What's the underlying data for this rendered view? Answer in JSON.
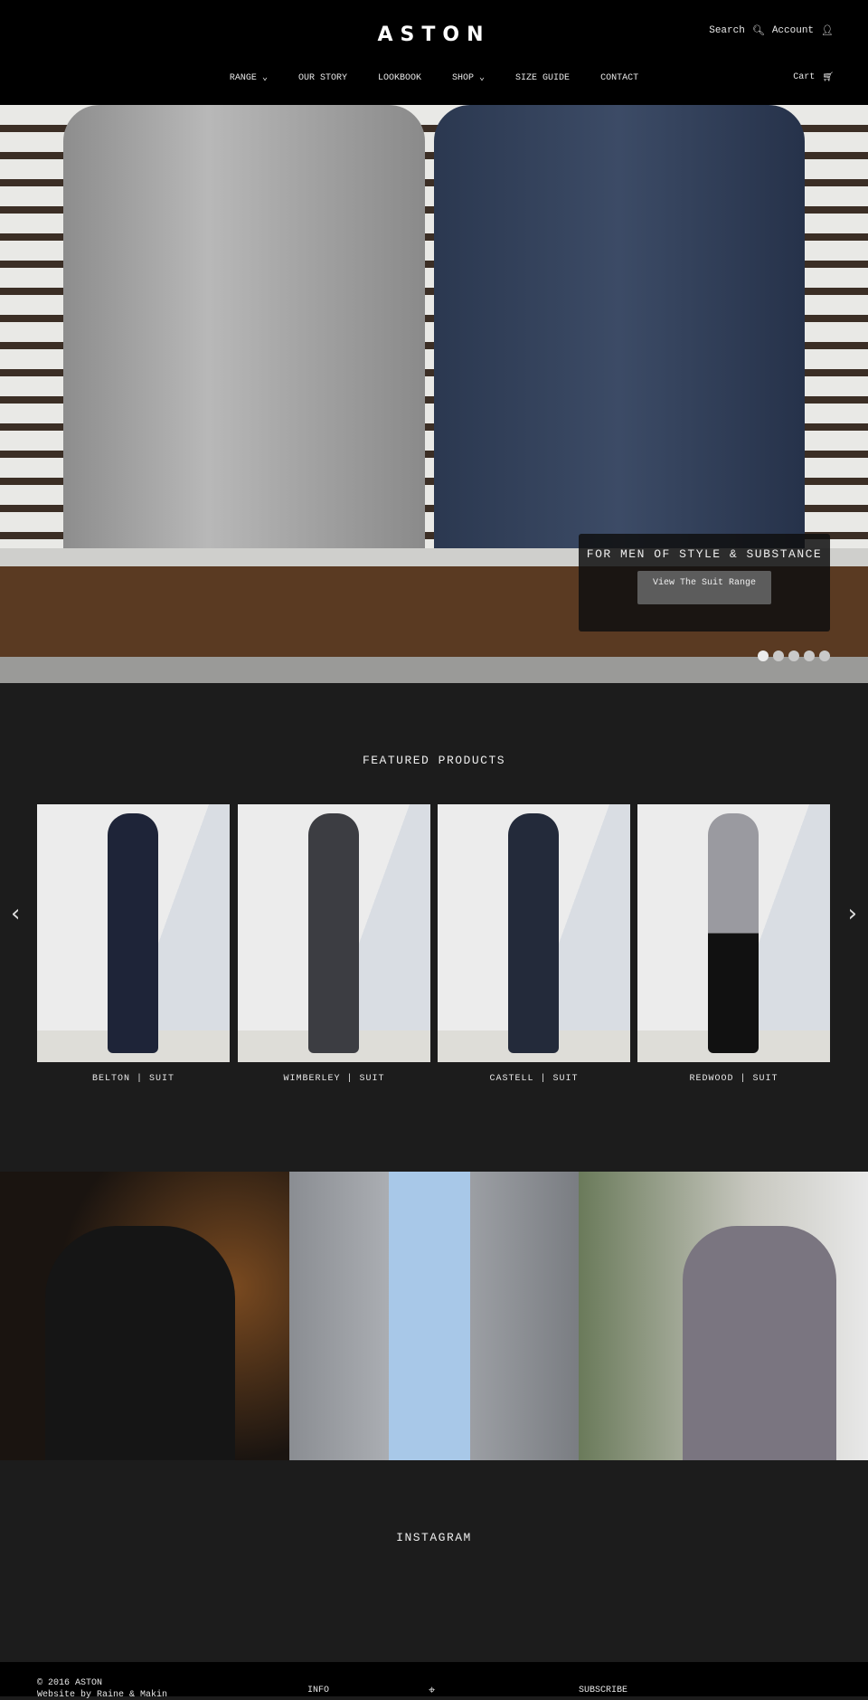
{
  "header": {
    "logo": "ASTON",
    "search_label": "Search",
    "account_label": "Account",
    "cart_label": "Cart",
    "nav": [
      {
        "label": "RANGE",
        "dropdown": true
      },
      {
        "label": "OUR STORY"
      },
      {
        "label": "LOOKBOOK"
      },
      {
        "label": "SHOP",
        "dropdown": true
      },
      {
        "label": "SIZE GUIDE"
      },
      {
        "label": "CONTACT"
      }
    ]
  },
  "hero": {
    "caption": "FOR MEN OF STYLE & SUBSTANCE",
    "button": "View The Suit Range",
    "slides": 5,
    "active_slide": 1
  },
  "featured": {
    "title": "FEATURED PRODUCTS",
    "products": [
      {
        "label": "BELTON | SUIT",
        "color": "#1e2438"
      },
      {
        "label": "WIMBERLEY | SUIT",
        "color": "#3c3d42"
      },
      {
        "label": "CASTELL | SUIT",
        "color": "#232a3a"
      },
      {
        "label": "REDWOOD | SUIT",
        "color": "#9a9aa0"
      }
    ]
  },
  "instagram": {
    "title": "INSTAGRAM"
  },
  "footer": {
    "copyright": "© 2016 ASTON",
    "credit": "Website by Raine & Makin",
    "info": "INFO",
    "subscribe": "SUBSCRIBE"
  }
}
